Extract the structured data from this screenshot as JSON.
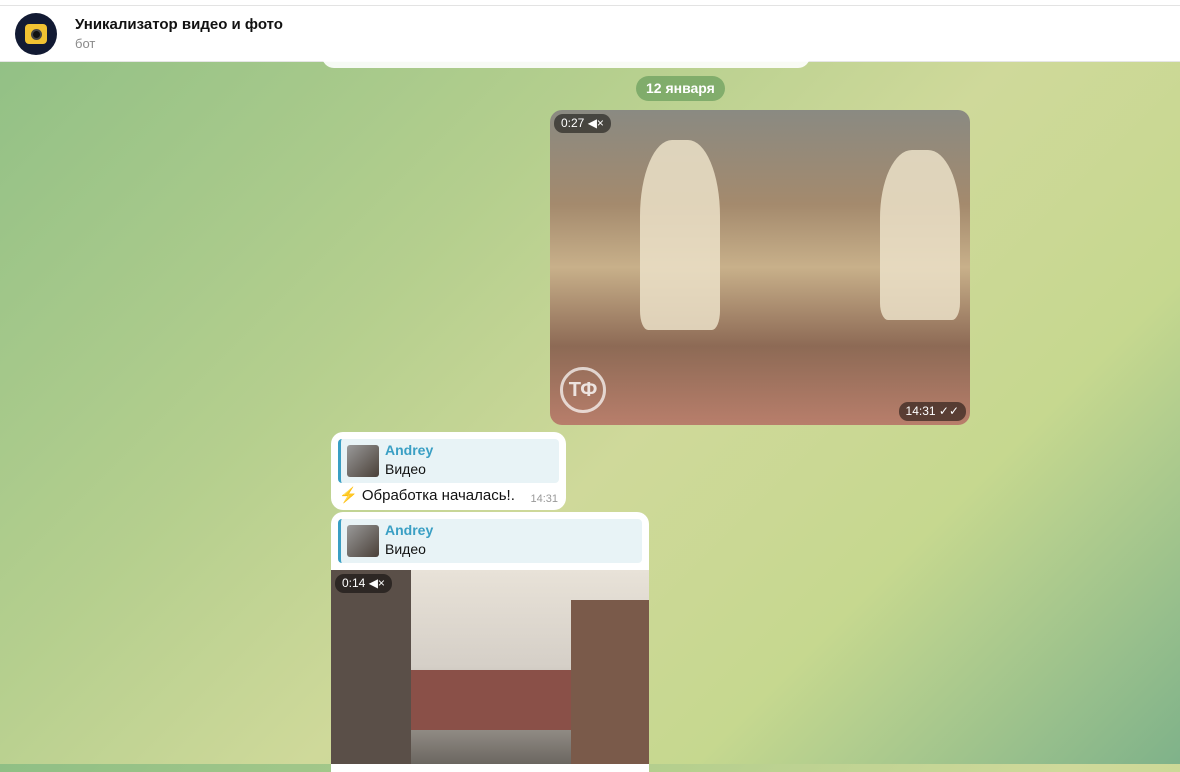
{
  "header": {
    "title": "Уникализатор видео и фото",
    "subtitle": "бот"
  },
  "date_separator": "12 января",
  "messages": [
    {
      "type": "video",
      "duration": "0:27",
      "time": "14:31",
      "status": "read"
    },
    {
      "type": "text",
      "reply_name": "Andrey",
      "reply_text": "Видео",
      "icon": "⚡",
      "text": "Обработка началась!.",
      "time": "14:31"
    },
    {
      "type": "video",
      "reply_name": "Andrey",
      "reply_text": "Видео",
      "duration": "0:14"
    }
  ],
  "icons": {
    "muted": "🔇"
  }
}
